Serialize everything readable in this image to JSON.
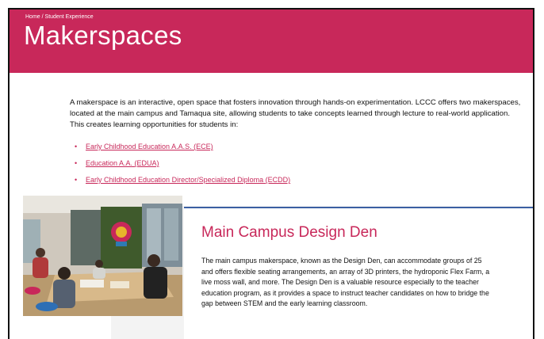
{
  "breadcrumb": {
    "home": "Home",
    "separator": " / ",
    "section": "Student Experience"
  },
  "page": {
    "title": "Makerspaces"
  },
  "intro": {
    "text": "A makerspace is an interactive, open space that fosters innovation through hands-on experimentation. LCCC offers two makerspaces, located at the main campus and Tamaqua site, allowing students to take concepts learned through lecture to real-world application. This creates learning opportunities for students in:"
  },
  "programs": [
    {
      "label": "Early Childhood Education A.A.S. (ECE)"
    },
    {
      "label": "Education A.A. (EDUA)"
    },
    {
      "label": "Early Childhood Education Director/Specialized Diploma (ECDD)"
    }
  ],
  "main_campus": {
    "title": "Main Campus Design Den",
    "body": "The main campus makerspace, known as the Design Den, can accommodate groups of 25 and offers flexible seating arrangements, an array of 3D printers, the hydroponic Flex Farm, a live moss wall, and more. The Design Den is a valuable resource especially to the teacher education program, as it provides a space to instruct teacher candidates on how to bridge the gap between STEM and the early learning classroom."
  },
  "colors": {
    "brand": "#c8285a",
    "accent_rule": "#3b5fa2",
    "panel": "#f3f3f3"
  }
}
